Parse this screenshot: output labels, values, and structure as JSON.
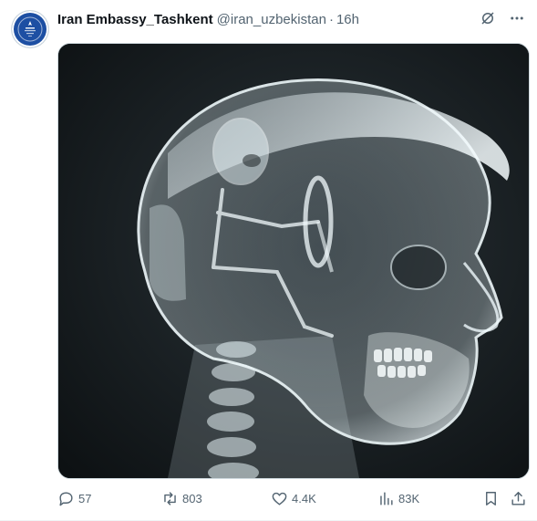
{
  "tweet": {
    "author_name": "Iran Embassy_Tashkent",
    "handle": "@iran_uzbekistan",
    "separator": "·",
    "time": "16h"
  },
  "top_actions": {
    "grok_icon": "grok-icon",
    "more_icon": "more-icon"
  },
  "media": {
    "kind": "x-ray style illustration"
  },
  "actions": {
    "replies": "57",
    "reposts": "803",
    "likes": "4.4K",
    "views": "83K"
  },
  "colors": {
    "text_secondary": "#536471",
    "avatar": "#1d4fa3",
    "border": "#cfd9de"
  }
}
